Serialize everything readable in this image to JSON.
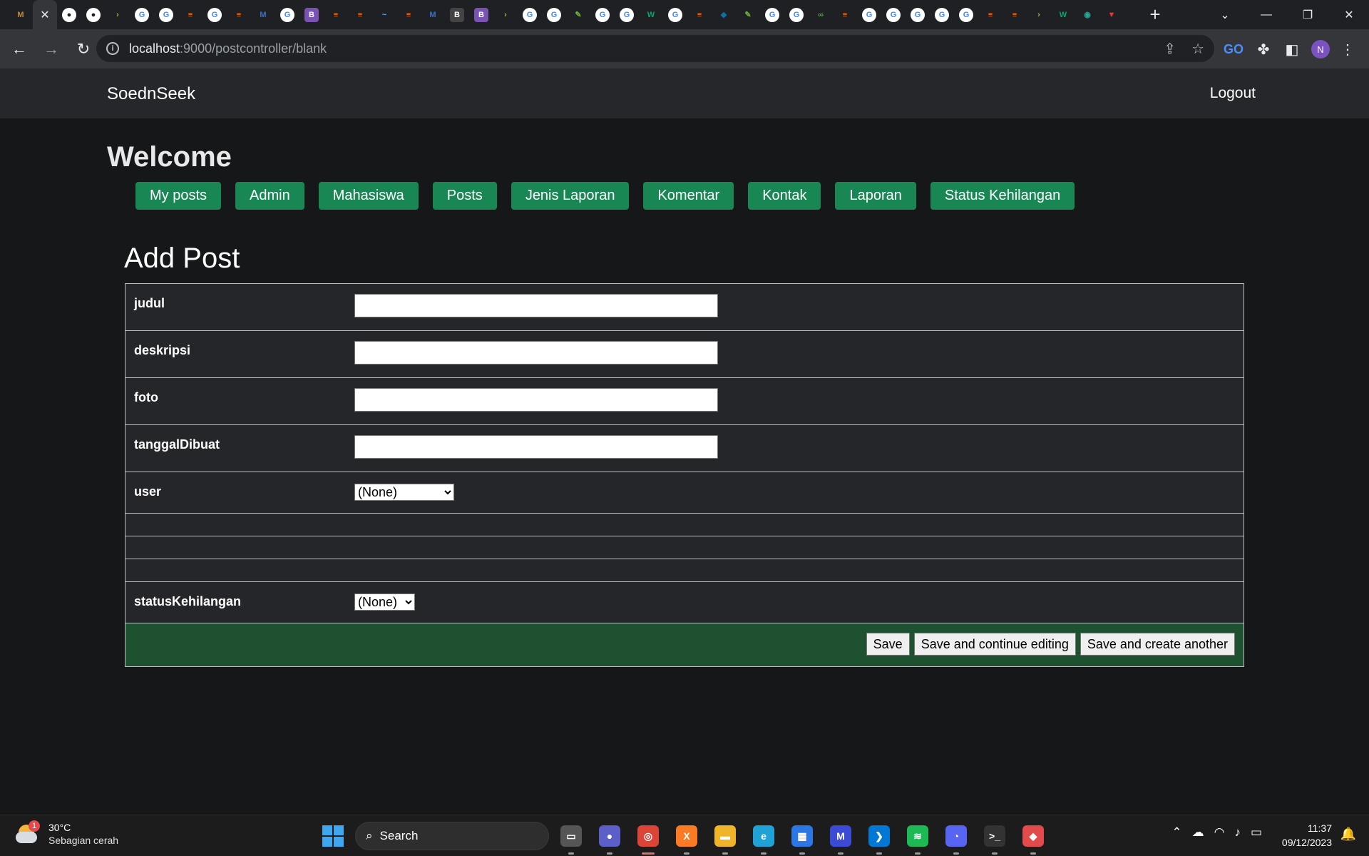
{
  "browser": {
    "tabs": [
      {
        "icon": "app-logo-icon",
        "color": "#c48b3a",
        "active": false,
        "glyph": "M"
      },
      {
        "icon": "close-icon",
        "color": "",
        "active": true,
        "glyph": "✕"
      },
      {
        "icon": "github-icon",
        "color": "#ffffff",
        "active": false,
        "glyph": "●"
      },
      {
        "icon": "github-icon",
        "color": "#ffffff",
        "active": false,
        "glyph": "●"
      },
      {
        "icon": "chevron-icon",
        "color": "#8bc34a",
        "active": false,
        "glyph": "›"
      },
      {
        "icon": "google-icon",
        "color": "#ffffff",
        "active": false,
        "glyph": "G"
      },
      {
        "icon": "google-icon",
        "color": "#ffffff",
        "active": false,
        "glyph": "G"
      },
      {
        "icon": "stackoverflow-icon",
        "color": "#f48024",
        "active": false,
        "glyph": "≡"
      },
      {
        "icon": "google-icon",
        "color": "#ffffff",
        "active": false,
        "glyph": "G"
      },
      {
        "icon": "stackoverflow-icon",
        "color": "#f48024",
        "active": false,
        "glyph": "≡"
      },
      {
        "icon": "mdb-icon",
        "color": "#3b71ca",
        "active": false,
        "glyph": "M"
      },
      {
        "icon": "google-icon",
        "color": "#ffffff",
        "active": false,
        "glyph": "G"
      },
      {
        "icon": "bootstrap-icon",
        "color": "#7952b3",
        "active": false,
        "glyph": "B"
      },
      {
        "icon": "stackoverflow-icon",
        "color": "#f48024",
        "active": false,
        "glyph": "≡"
      },
      {
        "icon": "stackoverflow-icon",
        "color": "#f48024",
        "active": false,
        "glyph": "≡"
      },
      {
        "icon": "tailwind-icon",
        "color": "#38bdf8",
        "active": false,
        "glyph": "~"
      },
      {
        "icon": "stackoverflow-icon",
        "color": "#f48024",
        "active": false,
        "glyph": "≡"
      },
      {
        "icon": "mdb-icon",
        "color": "#3b71ca",
        "active": false,
        "glyph": "M"
      },
      {
        "icon": "bootstrap-icon",
        "color": "#444444",
        "active": false,
        "glyph": "B"
      },
      {
        "icon": "bootstrap-icon",
        "color": "#7952b3",
        "active": false,
        "glyph": "B"
      },
      {
        "icon": "chevron-icon",
        "color": "#8bc34a",
        "active": false,
        "glyph": "›"
      },
      {
        "icon": "google-icon",
        "color": "#ffffff",
        "active": false,
        "glyph": "G"
      },
      {
        "icon": "google-icon",
        "color": "#ffffff",
        "active": false,
        "glyph": "G"
      },
      {
        "icon": "leaf-icon",
        "color": "#6db33f",
        "active": false,
        "glyph": "✎"
      },
      {
        "icon": "google-icon",
        "color": "#ffffff",
        "active": false,
        "glyph": "G"
      },
      {
        "icon": "google-icon",
        "color": "#ffffff",
        "active": false,
        "glyph": "G"
      },
      {
        "icon": "w3schools-icon",
        "color": "#04aa6d",
        "active": false,
        "glyph": "W"
      },
      {
        "icon": "google-icon",
        "color": "#ffffff",
        "active": false,
        "glyph": "G"
      },
      {
        "icon": "stackoverflow-icon",
        "color": "#f48024",
        "active": false,
        "glyph": "≡"
      },
      {
        "icon": "diamond-icon",
        "color": "#0f6fa8",
        "active": false,
        "glyph": "◆"
      },
      {
        "icon": "leaf-icon",
        "color": "#6db33f",
        "active": false,
        "glyph": "✎"
      },
      {
        "icon": "google-icon",
        "color": "#ffffff",
        "active": false,
        "glyph": "G"
      },
      {
        "icon": "google-icon",
        "color": "#ffffff",
        "active": false,
        "glyph": "G"
      },
      {
        "icon": "infinity-icon",
        "color": "#4caf50",
        "active": false,
        "glyph": "∞"
      },
      {
        "icon": "stackoverflow-icon",
        "color": "#f48024",
        "active": false,
        "glyph": "≡"
      },
      {
        "icon": "google-icon",
        "color": "#ffffff",
        "active": false,
        "glyph": "G"
      },
      {
        "icon": "google-icon",
        "color": "#ffffff",
        "active": false,
        "glyph": "G"
      },
      {
        "icon": "google-icon",
        "color": "#ffffff",
        "active": false,
        "glyph": "G"
      },
      {
        "icon": "google-icon",
        "color": "#ffffff",
        "active": false,
        "glyph": "G"
      },
      {
        "icon": "google-icon",
        "color": "#ffffff",
        "active": false,
        "glyph": "G"
      },
      {
        "icon": "stackoverflow-icon",
        "color": "#f48024",
        "active": false,
        "glyph": "≡"
      },
      {
        "icon": "stackoverflow-icon",
        "color": "#f48024",
        "active": false,
        "glyph": "≡"
      },
      {
        "icon": "chevron-icon",
        "color": "#8bc34a",
        "active": false,
        "glyph": "›"
      },
      {
        "icon": "w3schools-icon",
        "color": "#04aa6d",
        "active": false,
        "glyph": "W"
      },
      {
        "icon": "eye-icon",
        "color": "#26a69a",
        "active": false,
        "glyph": "◉"
      },
      {
        "icon": "vercel-icon",
        "color": "#e53935",
        "active": false,
        "glyph": "▼"
      }
    ],
    "url_host": "localhost",
    "url_path": ":9000/postcontroller/blank",
    "profile_initial": "N"
  },
  "app": {
    "brand": "SoednSeek",
    "logout": "Logout",
    "welcome": "Welcome",
    "menu": [
      "My posts",
      "Admin",
      "Mahasiswa",
      "Posts",
      "Jenis Laporan",
      "Komentar",
      "Kontak",
      "Laporan",
      "Status Kehilangan"
    ],
    "form_title": "Add Post",
    "fields": {
      "judul": {
        "label": "judul",
        "value": ""
      },
      "deskripsi": {
        "label": "deskripsi",
        "value": ""
      },
      "foto": {
        "label": "foto",
        "value": ""
      },
      "tanggal": {
        "label": "tanggalDibuat",
        "value": ""
      },
      "user": {
        "label": "user",
        "selected": "(None)"
      },
      "status": {
        "label": "statusKehilangan",
        "selected": "(None)"
      }
    },
    "buttons": {
      "save": "Save",
      "save_continue": "Save and continue editing",
      "save_another": "Save and create another"
    },
    "accent_color": "#198754",
    "submit_row_color": "#1e5130"
  },
  "taskbar": {
    "weather_temp": "30°C",
    "weather_cond": "Sebagian cerah",
    "weather_badge": "1",
    "search_label": "Search",
    "apps": [
      {
        "name": "task-view-icon",
        "color": "#555555",
        "glyph": "▭"
      },
      {
        "name": "teams-chat-icon",
        "color": "#5b5fc7",
        "glyph": "●"
      },
      {
        "name": "chrome-icon",
        "color": "#db4437",
        "glyph": "◎",
        "active": true
      },
      {
        "name": "xampp-icon",
        "color": "#fb7a24",
        "glyph": "X"
      },
      {
        "name": "file-explorer-icon",
        "color": "#f0b429",
        "glyph": "▬"
      },
      {
        "name": "edge-icon",
        "color": "#1fa2d6",
        "glyph": "e"
      },
      {
        "name": "microsoft-store-icon",
        "color": "#2b78e4",
        "glyph": "▦"
      },
      {
        "name": "app-icon",
        "color": "#3c4bd6",
        "glyph": "M"
      },
      {
        "name": "vscode-icon",
        "color": "#0078d4",
        "glyph": "❯"
      },
      {
        "name": "spotify-icon",
        "color": "#1db954",
        "glyph": "≋"
      },
      {
        "name": "discord-icon",
        "color": "#5865f2",
        "glyph": "◔"
      },
      {
        "name": "terminal-icon",
        "color": "#333333",
        "glyph": ">_"
      },
      {
        "name": "git-icon",
        "color": "#e24b4b",
        "glyph": "◆"
      }
    ],
    "time": "11:37",
    "date": "09/12/2023"
  }
}
